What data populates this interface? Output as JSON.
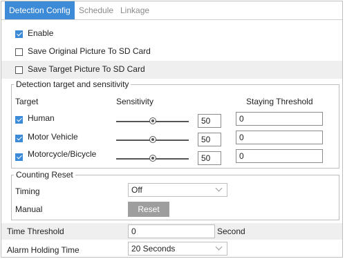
{
  "tabs": [
    {
      "label": "Detection Config",
      "active": true
    },
    {
      "label": "Schedule",
      "active": false
    },
    {
      "label": "Linkage",
      "active": false
    }
  ],
  "enable": {
    "label": "Enable",
    "checked": true
  },
  "save_original": {
    "label": "Save Original Picture To SD Card",
    "checked": false
  },
  "save_target": {
    "label": "Save Target Picture To SD Card",
    "checked": false
  },
  "detection": {
    "legend": "Detection target and sensitivity",
    "headers": {
      "target": "Target",
      "sensitivity": "Sensitivity",
      "staying": "Staying Threshold"
    },
    "rows": [
      {
        "label": "Human",
        "checked": true,
        "sensitivity": "50",
        "threshold": "0"
      },
      {
        "label": "Motor Vehicle",
        "checked": true,
        "sensitivity": "50",
        "threshold": "0"
      },
      {
        "label": "Motorcycle/Bicycle",
        "checked": true,
        "sensitivity": "50",
        "threshold": "0"
      }
    ]
  },
  "counting": {
    "legend": "Counting Reset",
    "timing_label": "Timing",
    "timing_value": "Off",
    "manual_label": "Manual",
    "reset_label": "Reset"
  },
  "time_threshold": {
    "label": "Time Threshold",
    "value": "0",
    "unit": "Second"
  },
  "alarm_holding": {
    "label": "Alarm Holding Time",
    "value": "20 Seconds"
  },
  "colors": {
    "accent": "#3d8bd6",
    "button": "#9e9e9e",
    "shaded_row": "#efefef"
  }
}
